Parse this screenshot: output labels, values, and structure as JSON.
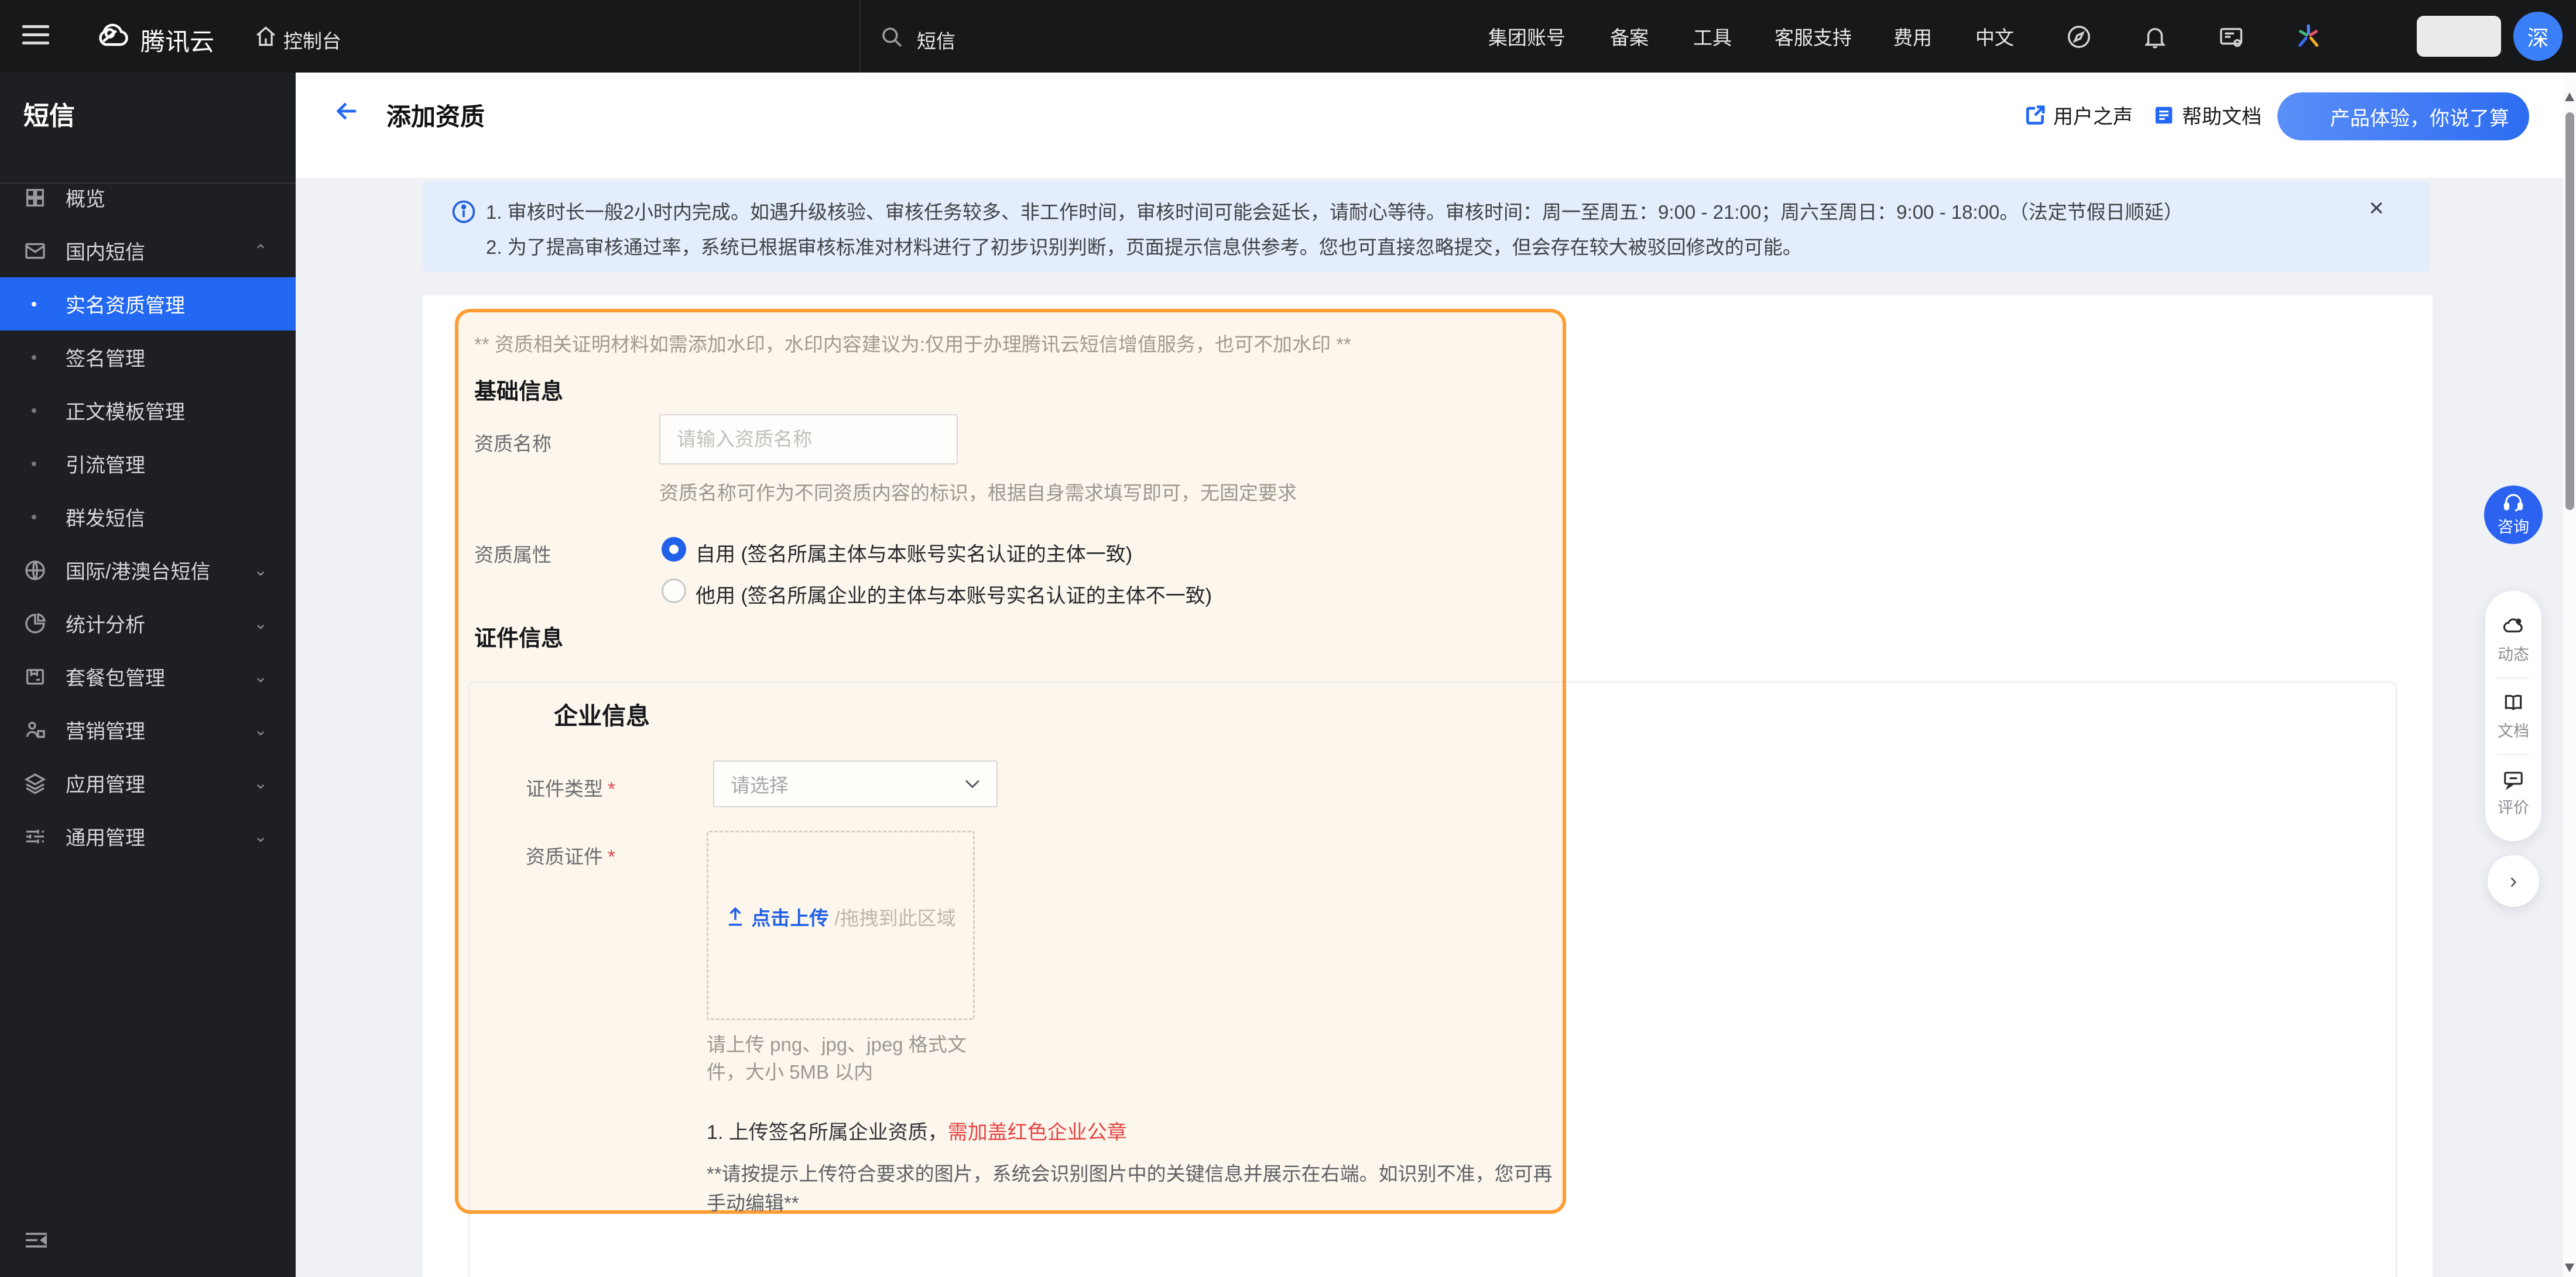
{
  "colors": {
    "primary_blue": "#2368F2",
    "orange_highlight": "#FF9C33",
    "red_warning": "#E64545",
    "banner_bg": "#E4EDFB",
    "topnav_bg": "#17181A",
    "sidebar_bg": "#1E1F23"
  },
  "nav": {
    "brand": "腾讯云",
    "console": "控制台",
    "search_text": "短信",
    "menu": [
      "集团账号",
      "备案",
      "工具",
      "客服支持",
      "费用",
      "中文"
    ],
    "avatar_text": "深"
  },
  "sidebar": {
    "title": "短信",
    "overview": "概览",
    "domestic": "国内短信",
    "sub": [
      "实名资质管理",
      "签名管理",
      "正文模板管理",
      "引流管理",
      "群发短信"
    ],
    "groups": [
      "国际/港澳台短信",
      "统计分析",
      "套餐包管理",
      "营销管理",
      "应用管理",
      "通用管理"
    ]
  },
  "header": {
    "title": "添加资质",
    "voice_link": "用户之声",
    "docs_link": "帮助文档",
    "experience_button": "产品体验，你说了算"
  },
  "banner": {
    "line1": "1. 审核时长一般2小时内完成。如遇升级核验、审核任务较多、非工作时间，审核时间可能会延长，请耐心等待。审核时间：周一至周五：9:00 - 21:00；周六至周日：9:00 - 18:00。（法定节假日顺延）",
    "line2": "2. 为了提高审核通过率，系统已根据审核标准对材料进行了初步识别判断，页面提示信息供参考。您也可直接忽略提交，但会存在较大被驳回修改的可能。",
    "close": "×"
  },
  "form": {
    "watermark_note": "** 资质相关证明材料如需添加水印，水印内容建议为:仅用于办理腾讯云短信增值服务，也可不加水印 **",
    "basic_section": "基础信息",
    "qual_name_label": "资质名称",
    "qual_name_placeholder": "请输入资质名称",
    "qual_name_help": "资质名称可作为不同资质内容的标识，根据自身需求填写即可，无固定要求",
    "qual_attr_label": "资质属性",
    "radio_self": "自用 (签名所属主体与本账号实名认证的主体一致)",
    "radio_other": "他用 (签名所属企业的主体与本账号实名认证的主体不一致)",
    "cert_section": "证件信息",
    "company_section": "企业信息",
    "cert_type_label": "证件类型",
    "required_mark": "*",
    "cert_type_placeholder": "请选择",
    "qual_cert_label": "资质证件",
    "upload_link": "点击上传",
    "upload_drag": "/拖拽到此区域",
    "upload_hint": "请上传 png、jpg、jpeg 格式文件，大小 5MB 以内",
    "note1_black": "1. 上传签名所属企业资质，",
    "note1_red": "需加盖红色企业公章",
    "note2": "**请按提示上传符合要求的图片，系统会识别图片中的关键信息并展示在右端。如识别不准，您可再手动编辑**"
  },
  "floating": {
    "consult": "咨询",
    "news": "动态",
    "doc": "文档",
    "rate": "评价"
  }
}
